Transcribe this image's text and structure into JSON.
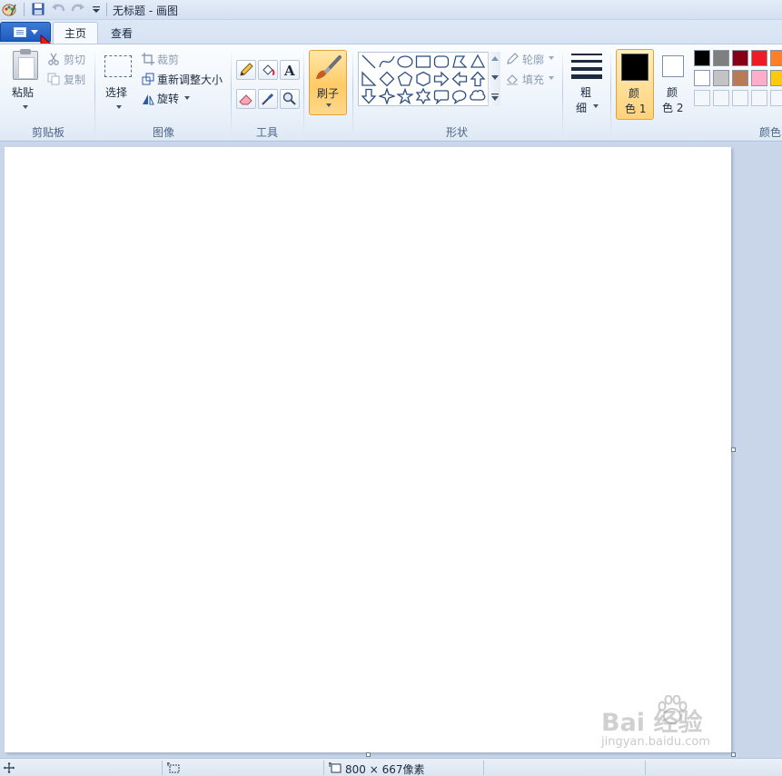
{
  "window": {
    "title": "无标题 - 画图"
  },
  "tabs": {
    "home": "主页",
    "view": "查看"
  },
  "clipboard": {
    "paste": "粘贴",
    "cut": "剪切",
    "copy": "复制",
    "group": "剪贴板"
  },
  "image": {
    "select": "选择",
    "crop": "裁剪",
    "resize": "重新调整大小",
    "rotate": "旋转",
    "group": "图像"
  },
  "tools": {
    "group": "工具"
  },
  "brushes": {
    "label": "刷子"
  },
  "shapes": {
    "outline": "轮廓",
    "fill": "填充",
    "group": "形状"
  },
  "size": {
    "label_top": "粗",
    "label_bottom": "细"
  },
  "colors": {
    "color1_top": "颜",
    "color1_bottom": "色 1",
    "color2_top": "颜",
    "color2_bottom": "色 2",
    "group": "颜色",
    "primary": "#000000",
    "secondary": "#ffffff",
    "palette_row1": [
      "#000000",
      "#7f7f7f",
      "#880015",
      "#ed1c24",
      "#ff7f27"
    ],
    "palette_row2": [
      "#ffffff",
      "#c3c3c3",
      "#b97a57",
      "#ffaec9",
      "#ffc90e"
    ]
  },
  "status": {
    "canvas_size": "800 × 667像素"
  },
  "watermark": {
    "brand": "Bai 经验",
    "url": "jingyan.baidu.com"
  }
}
